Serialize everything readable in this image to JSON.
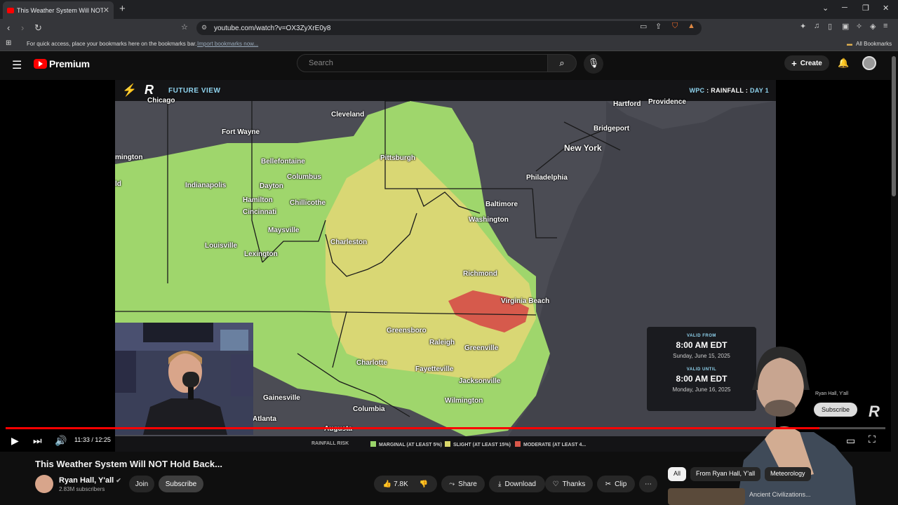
{
  "browser": {
    "tab_title": "This Weather System Will NOT",
    "tab_close": "✕",
    "new_tab": "+",
    "url": "youtube.com/watch?v=OX3ZyXrE0y8",
    "bookmarks_hint": "For quick access, place your bookmarks here on the bookmarks bar.",
    "import_link": "Import bookmarks now...",
    "all_bookmarks": "All Bookmarks"
  },
  "yt_header": {
    "logo_text": "Premium",
    "search_placeholder": "Search",
    "create_label": "Create"
  },
  "video": {
    "brand_label": "FUTURE VIEW",
    "product_a": "WPC",
    "sep": ":",
    "product_b": "RAINFALL",
    "product_c": "DAY 1",
    "valid_from_label": "VALID FROM",
    "valid_from_time": "8:00 AM EDT",
    "valid_from_date": "Sunday, June 15, 2025",
    "valid_until_label": "VALID UNTIL",
    "valid_until_time": "8:00 AM EDT",
    "valid_until_date": "Monday, June 16, 2025",
    "legend_title": "RAINFALL RISK",
    "legend_items": [
      {
        "label": "MARGINAL (AT LEAST 5%)",
        "color": "#9ad46a"
      },
      {
        "label": "SLIGHT (AT LEAST 15%)",
        "color": "#d8d66a"
      },
      {
        "label": "MODERATE (AT LEAST 4...",
        "color": "#d9574a"
      }
    ],
    "cities": {
      "chicago": "Chicago",
      "cleveland": "Cleveland",
      "fort_wayne": "Fort Wayne",
      "hartford": "Hartford",
      "providence": "Providence",
      "bridgeport": "Bridgeport",
      "new_york": "New York",
      "mington": "mington",
      "bellefontaine": "Bellefontaine",
      "pittsburgh": "Pittsburgh",
      "columbus": "Columbus",
      "philadelphia": "Philadelphia",
      "indianapolis": "Indianapolis",
      "dayton": "Dayton",
      "ld": "ld",
      "hamilton": "Hamilton",
      "chillicothe": "Chillicothe",
      "cincinnati": "Cincinnati",
      "baltimore": "Baltimore",
      "washington": "Washington",
      "maysville": "Maysville",
      "charleston": "Charleston",
      "louisville": "Louisville",
      "lexington": "Lexington",
      "richmond": "Richmond",
      "virginia_beach": "Virginia Beach",
      "greensboro": "Greensboro",
      "raleigh": "Raleigh",
      "greenville": "Greenville",
      "charlotte": "Charlotte",
      "fayetteville": "Fayetteville",
      "jacksonville": "Jacksonville",
      "gainesville": "Gainesville",
      "columbia": "Columbia",
      "wilmington": "Wilmington",
      "atlanta": "Atlanta",
      "augusta": "Augusta"
    },
    "overlay_channel": "Ryan Hall, Y'all",
    "overlay_subscribe": "Subscribe",
    "time_display": "11:33 / 12:25",
    "progress_fraction": 0.925
  },
  "below": {
    "title": "This Weather System Will NOT Hold Back...",
    "channel": "Ryan Hall, Y'all",
    "verified": "✔",
    "subscribers": "2.83M subscribers",
    "join": "Join",
    "subscribe": "Subscribe",
    "likes": "7.8K",
    "share": "Share",
    "download": "Download",
    "thanks": "Thanks",
    "clip": "Clip",
    "more": "⋯",
    "chips": [
      "All",
      "From Ryan Hall, Y'all",
      "Meteorology"
    ],
    "next_video": "Ancient Civilizations..."
  }
}
